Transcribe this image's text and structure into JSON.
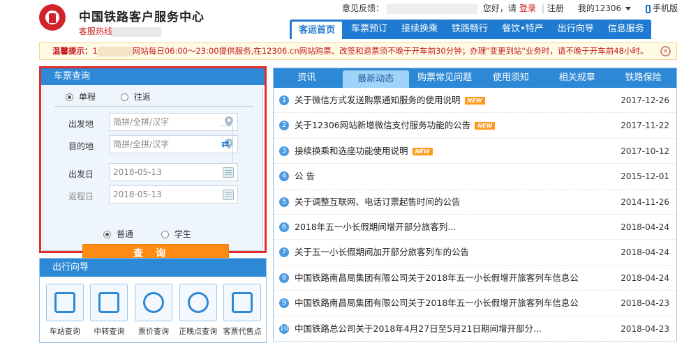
{
  "header": {
    "brand": "中国铁路客户服务中心",
    "hotline_label": "客服热线",
    "feedback_label": "意见反馈：",
    "greeting": "您好，请",
    "login": "登录",
    "register": "注册",
    "my12306": "我的12306",
    "mobile": "手机版"
  },
  "nav": {
    "items": [
      "客运首页",
      "车票预订",
      "接续换乘",
      "铁路畅行",
      "餐饮•特产",
      "出行向导",
      "信息服务"
    ],
    "active": "客运首页"
  },
  "notice": {
    "label": "温馨提示：",
    "lead": "1",
    "text": "网站每日06:00～23:00提供服务,在12306.cn网站购票、改签和退票须不晚于开车前30分钟；办理\"变更到站\"业务时，请不晚于开车前48小时。"
  },
  "query": {
    "title": "车票查询",
    "trip_oneway": "单程",
    "trip_return": "往返",
    "from_label": "出发地",
    "to_label": "目的地",
    "depart_label": "出发日",
    "return_label": "返程日",
    "from_placeholder": "简拼/全拼/汉字",
    "to_placeholder": "简拼/全拼/汉字",
    "depart_date": "2018-05-13",
    "return_date": "2018-05-13",
    "pax_normal": "普通",
    "pax_student": "学生",
    "search_label": "查询"
  },
  "guide": {
    "title": "出行向导",
    "items": [
      "车站查询",
      "中转查询",
      "票价查询",
      "正晚点查询",
      "客票代售点"
    ]
  },
  "news": {
    "tabs": [
      "资讯",
      "最新动态",
      "购票常见问题",
      "使用须知",
      "相关规章",
      "铁路保险"
    ],
    "active_tab": "最新动态",
    "new_badge": "NEW",
    "rows": [
      {
        "num": "1",
        "title": "关于微信方式发送购票通知服务的使用说明",
        "date": "2017-12-26",
        "new": true
      },
      {
        "num": "2",
        "title": "关于12306网站新增微信支付服务功能的公告",
        "date": "2017-11-22",
        "new": true
      },
      {
        "num": "3",
        "title": "接续换乘和选座功能使用说明",
        "date": "2017-10-12",
        "new": true
      },
      {
        "num": "4",
        "title": "公 告",
        "date": "2015-12-01",
        "new": false
      },
      {
        "num": "5",
        "title": "关于调整互联网、电话订票起售时间的公告",
        "date": "2014-11-26",
        "new": false
      },
      {
        "num": "6",
        "title": "2018年五一小长假期间增开部分旅客列...",
        "date": "2018-04-24",
        "new": false
      },
      {
        "num": "7",
        "title": "关于五一小长假期间加开部分旅客列车的公告",
        "date": "2018-04-24",
        "new": false
      },
      {
        "num": "8",
        "title": "中国铁路南昌局集团有限公司关于2018年五一小长假增开旅客列车信息公",
        "date": "2018-04-24",
        "new": false
      },
      {
        "num": "9",
        "title": "中国铁路南昌局集团有限公司关于2018年五一小长假增开旅客列车信息公",
        "date": "2018-04-23",
        "new": false
      },
      {
        "num": "10",
        "title": "中国铁路总公司关于2018年4月27日至5月21日期间增开部分...",
        "date": "2018-04-23",
        "new": false
      }
    ]
  },
  "colors": {
    "primary": "#2d89d6",
    "accent_red": "#d1232a",
    "search_orange": "#ff8a14",
    "highlight_border": "#e52a2a"
  }
}
